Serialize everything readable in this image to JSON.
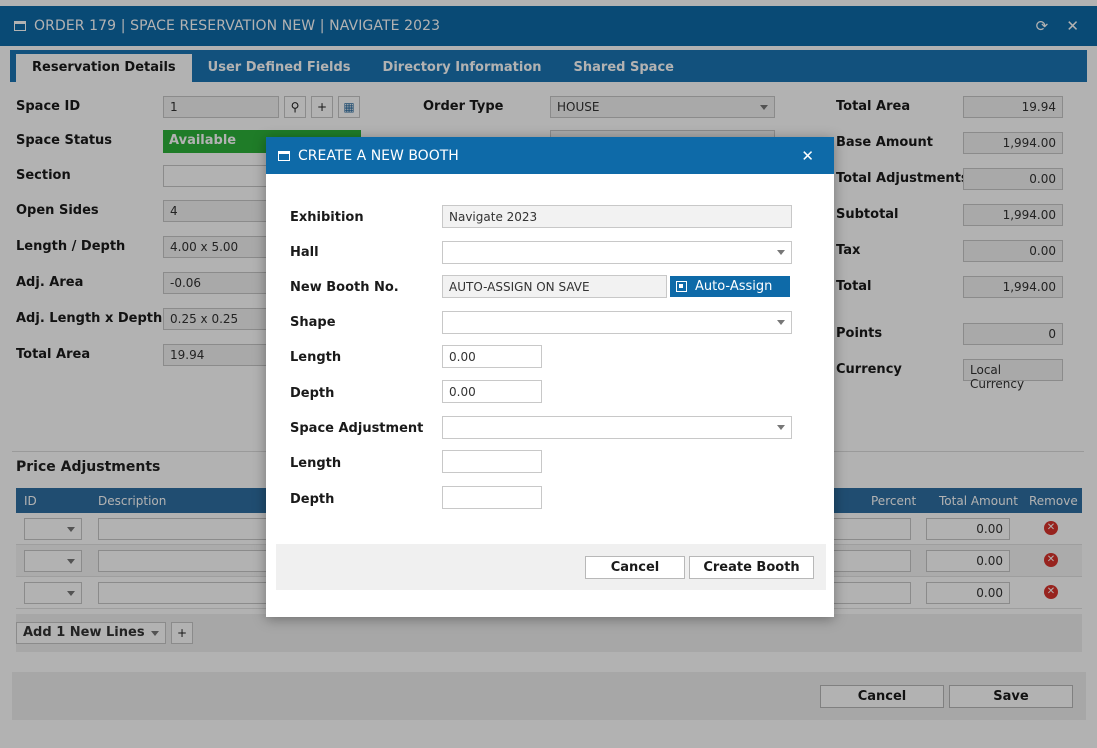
{
  "window": {
    "title": "ORDER 179 | SPACE RESERVATION NEW | NAVIGATE 2023",
    "refresh_icon": "⟳",
    "close_icon": "✕"
  },
  "tabs": [
    "Reservation Details",
    "User Defined Fields",
    "Directory Information",
    "Shared Space"
  ],
  "left_fields": {
    "space_id_label": "Space ID",
    "space_id": "1",
    "space_status_label": "Space Status",
    "space_status": "Available",
    "section_label": "Section",
    "section": "",
    "open_sides_label": "Open Sides",
    "open_sides": "4",
    "length_depth_label": "Length / Depth",
    "length_depth": "4.00 x 5.00",
    "adj_area_label": "Adj. Area",
    "adj_area": "-0.06",
    "adj_lxd_label": "Adj. Length x Depth",
    "adj_lxd": "0.25 x 0.25",
    "total_area_label": "Total Area",
    "total_area": "19.94"
  },
  "middle_fields": {
    "order_type_label": "Order Type",
    "order_type": "HOUSE"
  },
  "right_fields": {
    "total_area_label": "Total Area",
    "total_area": "19.94",
    "base_amount_label": "Base Amount",
    "base_amount": "1,994.00",
    "total_adj_label": "Total Adjustments",
    "total_adj": "0.00",
    "subtotal_label": "Subtotal",
    "subtotal": "1,994.00",
    "tax_label": "Tax",
    "tax": "0.00",
    "total_label": "Total",
    "total": "1,994.00",
    "points_label": "Points",
    "points": "0",
    "currency_label": "Currency",
    "currency": "Local Currency"
  },
  "price_adjustments": {
    "title": "Price Adjustments",
    "columns": [
      "ID",
      "Description",
      "Percent",
      "Total Amount",
      "Remove"
    ],
    "rows": [
      {
        "total": "0.00"
      },
      {
        "total": "0.00"
      },
      {
        "total": "0.00"
      }
    ],
    "add_lines": "Add 1 New Lines",
    "add_icon": "+"
  },
  "footer": {
    "cancel": "Cancel",
    "save": "Save"
  },
  "modal": {
    "title": "CREATE A NEW BOOTH",
    "close_icon": "✕",
    "exhibition_label": "Exhibition",
    "exhibition": "Navigate 2023",
    "hall_label": "Hall",
    "hall": "",
    "booth_no_label": "New Booth No.",
    "booth_no": "AUTO-ASSIGN ON SAVE",
    "auto_assign": "Auto-Assign",
    "shape_label": "Shape",
    "shape": "",
    "length_label": "Length",
    "length": "0.00",
    "depth_label": "Depth",
    "depth": "0.00",
    "space_adj_label": "Space Adjustment",
    "space_adj": "",
    "length2_label": "Length",
    "length2": "",
    "depth2_label": "Depth",
    "depth2": "",
    "cancel": "Cancel",
    "create": "Create Booth"
  }
}
